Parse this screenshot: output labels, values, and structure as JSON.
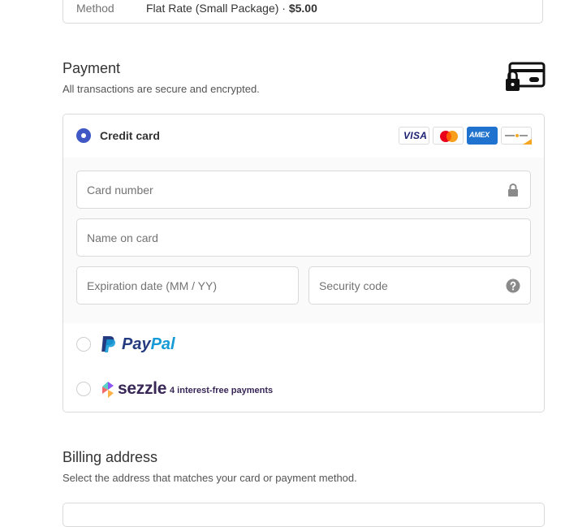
{
  "shipping": {
    "method_label": "Method",
    "method_name": "Flat Rate (Small Package) · ",
    "method_price": "$5.00"
  },
  "payment": {
    "title": "Payment",
    "subtitle": "All transactions are secure and encrypted.",
    "credit_card": {
      "label": "Credit card",
      "selected": true,
      "brands": [
        {
          "name": "VISA",
          "icon": "visa-logo"
        },
        {
          "name": "Mastercard",
          "icon": "mastercard-logo"
        },
        {
          "name": "AMEX",
          "icon": "amex-logo"
        },
        {
          "name": "Other card",
          "icon": "generic-card-logo"
        }
      ],
      "fields": {
        "card_number_placeholder": "Card number",
        "name_placeholder": "Name on card",
        "expiry_placeholder": "Expiration date (MM / YY)",
        "security_placeholder": "Security code"
      }
    },
    "paypal": {
      "pay": "Pay",
      "pal": "Pal",
      "selected": false
    },
    "sezzle": {
      "name": "sezzle",
      "tagline": "4 interest-free payments",
      "selected": false
    }
  },
  "billing": {
    "title": "Billing address",
    "subtitle": "Select the address that matches your card or payment method."
  },
  "colors": {
    "accent": "#3f58c4",
    "border": "#d9d9d9",
    "paypal_dark": "#253b80",
    "paypal_light": "#179bd7",
    "sezzle_purple": "#382757"
  }
}
